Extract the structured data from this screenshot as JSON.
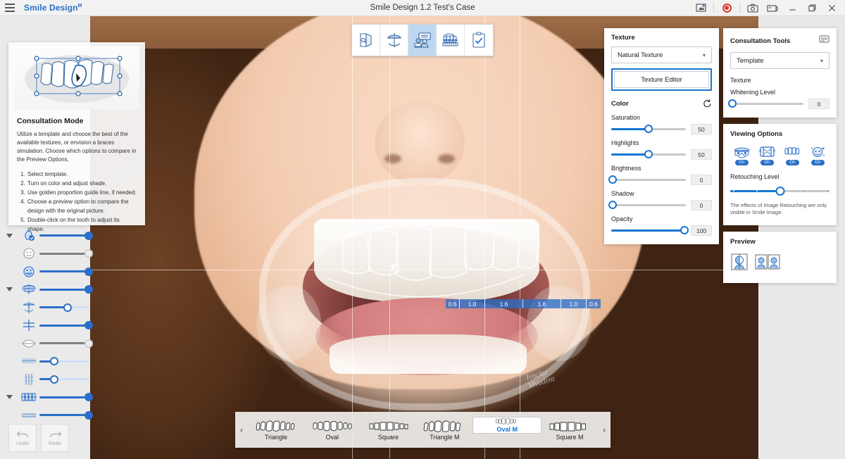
{
  "titlebar": {
    "menu_icon": "hamburger-icon",
    "app_name": "Smile Design",
    "app_name_sup": "M",
    "window_title": "Smile Design 1.2 Test's Case",
    "buttons": [
      {
        "name": "screen-capture-icon",
        "label": ""
      },
      {
        "name": "record-icon",
        "label": ""
      },
      {
        "name": "camera-icon",
        "label": ""
      },
      {
        "name": "image-icon",
        "label": ""
      },
      {
        "name": "minimize-icon",
        "label": ""
      },
      {
        "name": "restore-icon",
        "label": ""
      },
      {
        "name": "close-icon",
        "label": ""
      }
    ]
  },
  "help_card": {
    "title": "Consultation Mode",
    "body": "Utilize a template and choose the best of the available textures, or envision a braces simulation. Choose which options to compare in the Preview Options.",
    "steps": [
      "Select template.",
      "Turn on color and adjust shade.",
      "Use golden proportion guide line, if needed.",
      "Choose a preview option to compare the design with the original picture.",
      "Double-click on the tooth to adjust its shape."
    ]
  },
  "center_tools": [
    {
      "name": "tool-image-compare",
      "active": false
    },
    {
      "name": "tool-guide-lines",
      "active": false
    },
    {
      "name": "tool-consultation-mode",
      "active": true
    },
    {
      "name": "tool-braces-simulation",
      "active": false
    },
    {
      "name": "tool-checklist",
      "active": false
    }
  ],
  "left_sliders": [
    {
      "name": "slider-face-profile",
      "icon": "face-profile-icon",
      "group": true,
      "value": 100,
      "enabled": true
    },
    {
      "name": "slider-face-plain",
      "icon": "face-icon",
      "group": false,
      "value": 100,
      "enabled": false
    },
    {
      "name": "slider-face-smile",
      "icon": "face-smile-icon",
      "group": false,
      "value": 100,
      "enabled": true
    },
    {
      "name": "slider-arch-guide",
      "icon": "dental-arch-icon",
      "group": true,
      "value": 100,
      "enabled": true
    },
    {
      "name": "slider-midline-cross",
      "icon": "midline-cross-icon",
      "group": false,
      "value": 57,
      "enabled": true
    },
    {
      "name": "slider-grid-cross",
      "icon": "grid-cross-icon",
      "group": false,
      "value": 100,
      "enabled": true
    },
    {
      "name": "slider-lips",
      "icon": "lips-icon",
      "group": false,
      "value": 100,
      "enabled": false
    },
    {
      "name": "slider-tooth-strip",
      "icon": "tooth-strip-icon",
      "group": false,
      "value": 30,
      "enabled": true
    },
    {
      "name": "slider-vertical-lines",
      "icon": "vertical-lines-icon",
      "group": false,
      "value": 30,
      "enabled": true
    },
    {
      "name": "slider-braces",
      "icon": "braces-icon",
      "group": true,
      "value": 100,
      "enabled": true
    },
    {
      "name": "slider-teeth-row",
      "icon": "teeth-row-icon",
      "group": false,
      "value": 100,
      "enabled": true
    }
  ],
  "undo_redo": {
    "undo_label": "Undo",
    "redo_label": "Redo"
  },
  "texture_panel": {
    "title": "Texture",
    "select_value": "Natural Texture",
    "editor_button": "Texture Editor",
    "color_title": "Color",
    "reset_icon": "reset-icon",
    "controls": [
      {
        "name": "saturation",
        "label": "Saturation",
        "value": 50,
        "max": 100
      },
      {
        "name": "highlights",
        "label": "Highlights",
        "value": 50,
        "max": 100
      },
      {
        "name": "brightness",
        "label": "Brightness",
        "value": 0,
        "max": 100
      },
      {
        "name": "shadow",
        "label": "Shadow",
        "value": 0,
        "max": 100
      },
      {
        "name": "opacity",
        "label": "Opacity",
        "value": 100,
        "max": 100
      }
    ]
  },
  "consultation_tools": {
    "title": "Consultation Tools",
    "header_icon": "keyboard-panel-icon",
    "select_value": "Template",
    "texture_label": "Texture",
    "texture_on": true,
    "whitening_label": "Whitening Level",
    "whitening_value": 0
  },
  "viewing_options": {
    "title": "Viewing Options",
    "items": [
      {
        "name": "viewing-option-disguise",
        "icon": "disguise-face-icon",
        "state": "On"
      },
      {
        "name": "viewing-option-retractor",
        "icon": "retractor-icon",
        "state": "On"
      },
      {
        "name": "viewing-option-teeth",
        "icon": "teeth-arch-icon",
        "state": "On"
      },
      {
        "name": "viewing-option-retouch",
        "icon": "sparkle-face-icon",
        "state": "On"
      }
    ],
    "retouching_label": "Retouching Level",
    "retouching_value": 50,
    "note": "The effects of Image Retouching are only visible in Smile Image."
  },
  "preview": {
    "title": "Preview",
    "items": [
      {
        "name": "preview-split-view",
        "icon": "split-view-icon"
      },
      {
        "name": "preview-side-by-side",
        "icon": "side-by-side-icon"
      }
    ]
  },
  "carousel": {
    "prev_icon": "chevron-left-icon",
    "next_icon": "chevron-right-icon",
    "items": [
      {
        "label": "Triangle",
        "selected": false
      },
      {
        "label": "Oval",
        "selected": false
      },
      {
        "label": "Square",
        "selected": false
      },
      {
        "label": "Triangle M",
        "selected": false
      },
      {
        "label": "Oval M",
        "selected": true
      },
      {
        "label": "Square M",
        "selected": false
      }
    ]
  },
  "overlay": {
    "golden_ratios": [
      "0.6",
      "1.0",
      "1.6",
      "1.6",
      "1.0",
      "0.6"
    ]
  },
  "colors": {
    "accent": "#1775d1",
    "accent_dark": "#2a6fc9",
    "record": "#e03c31",
    "panel_bg": "#ffffff",
    "rail_bg": "#eaeaea"
  }
}
